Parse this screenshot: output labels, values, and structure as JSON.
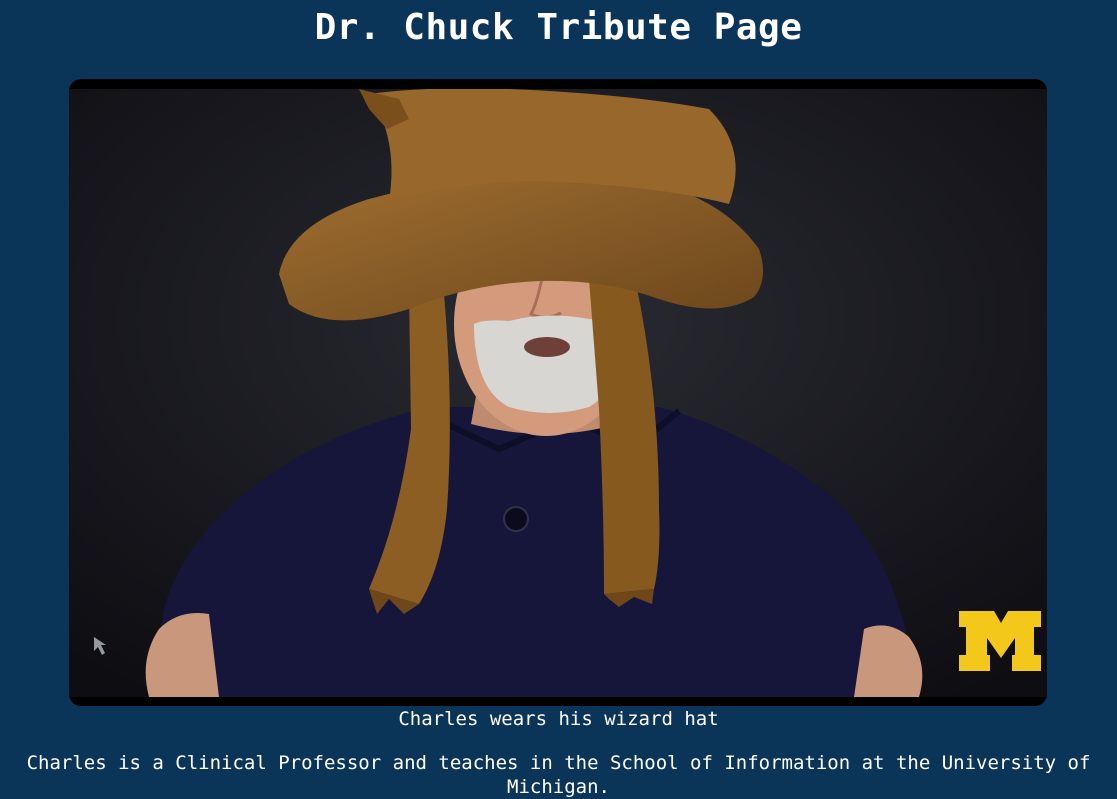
{
  "page": {
    "title": "Dr. Chuck Tribute Page"
  },
  "figure": {
    "caption": "Charles wears his wizard hat",
    "logo_letter": "M",
    "subject": "Charles wearing a brown wizard hat and navy polo shirt"
  },
  "bio": {
    "text": "Charles is a Clinical Professor and teaches in the School of Information at the University of Michigan."
  },
  "colors": {
    "background": "#0b3558",
    "text": "#ffffff",
    "hat": "#8c5e24",
    "shirt": "#15163a",
    "maize": "#f3c81b"
  }
}
